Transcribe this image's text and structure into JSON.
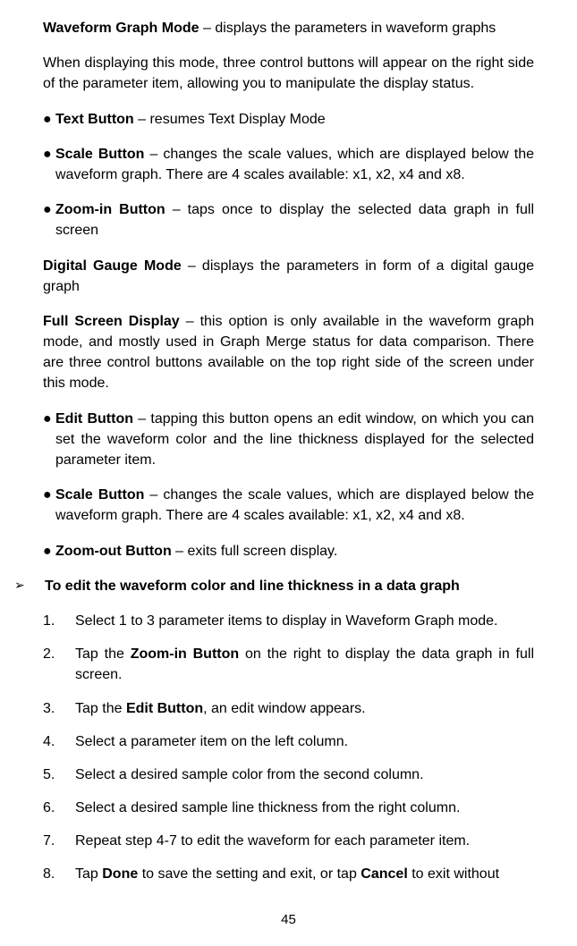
{
  "waveform_mode_title": "Waveform Graph Mode",
  "waveform_mode_desc": " – displays the parameters in waveform graphs",
  "waveform_mode_para": "When displaying this mode, three control buttons will appear on the right side of the parameter item, allowing you to manipulate the display status.",
  "text_btn_title": "Text Button",
  "text_btn_desc": " – resumes Text Display Mode",
  "scale_btn_title": "Scale Button",
  "scale_btn_desc": " – changes the scale values, which are displayed below the waveform graph. There are 4 scales available: x1, x2, x4 and x8.",
  "zoomin_btn_title": "Zoom-in Button",
  "zoomin_btn_desc": " – taps once to display the selected data graph in full screen",
  "digital_title": "Digital Gauge Mode",
  "digital_desc": " – displays the parameters in form of a digital gauge graph",
  "fullscreen_title": "Full Screen Display",
  "fullscreen_desc": " – this option is only available in the waveform graph mode, and mostly used in Graph Merge status for data comparison. There are three control buttons available on the top right side of the screen under this mode.",
  "edit_btn_title": "Edit Button",
  "edit_btn_desc": " – tapping this button opens an edit window, on which you can set the waveform color and the line thickness displayed for the selected parameter item.",
  "scale_btn2_title": "Scale Button",
  "scale_btn2_desc": " – changes the scale values, which are displayed below the waveform graph. There are 4 scales available: x1, x2, x4 and x8.",
  "zoomout_btn_title": "Zoom-out Button",
  "zoomout_btn_desc": " – exits full screen display.",
  "arrow_heading": "To edit the waveform color and line thickness in a data graph",
  "step1": "Select 1 to 3 parameter items to display in Waveform Graph mode.",
  "step2_pre": "Tap the ",
  "step2_bold": "Zoom-in Button",
  "step2_post": " on the right to display the data graph in full screen.",
  "step3_pre": "Tap the ",
  "step3_bold": "Edit Button",
  "step3_post": ", an edit window appears.",
  "step4": "Select a parameter item on the left column.",
  "step5": "Select a desired sample color from the second column.",
  "step6": "Select a desired sample line thickness from the right column.",
  "step7": "Repeat step 4-7 to edit the waveform for each parameter item.",
  "step8_pre": "Tap ",
  "step8_bold1": "Done",
  "step8_mid": " to save the setting and exit, or tap ",
  "step8_bold2": "Cancel",
  "step8_post": " to exit without",
  "n1": "1.",
  "n2": "2.",
  "n3": "3.",
  "n4": "4.",
  "n5": "5.",
  "n6": "6.",
  "n7": "7.",
  "n8": "8.",
  "bullet": "●",
  "arrow": "➢",
  "page": "45"
}
